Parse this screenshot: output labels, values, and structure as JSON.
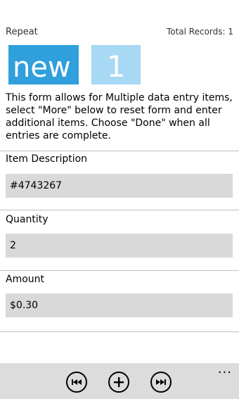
{
  "header": {
    "title": "Repeat",
    "total_records": "Total Records: 1"
  },
  "tiles": {
    "new_label": "new",
    "count": "1"
  },
  "description": "This form allows for Multiple data entry items, select \"More\" below to reset form and enter additional items.  Choose \"Done\" when all entries are complete.",
  "fields": [
    {
      "label": "Item Description",
      "value": "#4743267"
    },
    {
      "label": "Quantity",
      "value": "2"
    },
    {
      "label": "Amount",
      "value": "$0.30"
    }
  ],
  "appbar": {
    "buttons": [
      {
        "icon": "previous-icon"
      },
      {
        "icon": "add-icon"
      },
      {
        "icon": "next-icon"
      }
    ],
    "more_label": "..."
  },
  "colors": {
    "accent": "#2fa0dc",
    "accent_light": "#a7d8f4",
    "field_bg": "#d9d9d9",
    "appbar_bg": "#dcdcdc"
  }
}
